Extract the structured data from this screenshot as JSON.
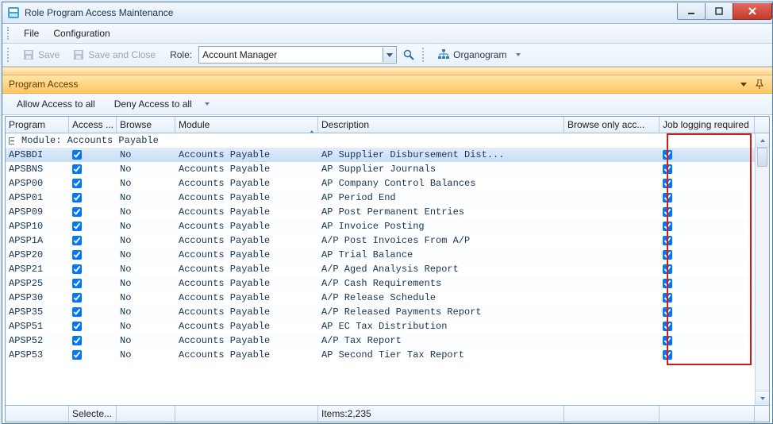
{
  "window": {
    "title": "Role Program Access Maintenance"
  },
  "menu": {
    "file": "File",
    "configuration": "Configuration"
  },
  "toolbar": {
    "save": "Save",
    "save_close": "Save and Close",
    "role_label": "Role:",
    "role_value": "Account Manager",
    "organogram": "Organogram"
  },
  "panel": {
    "title": "Program Access"
  },
  "access_bar": {
    "allow_all": "Allow Access to all",
    "deny_all": "Deny Access to all"
  },
  "columns": {
    "program": "Program",
    "access": "Access ...",
    "browse": "Browse",
    "module": "Module",
    "description": "Description",
    "browse_only": "Browse only acc...",
    "job_logging": "Job logging required"
  },
  "group": {
    "prefix_label": "Module:",
    "value": "Accounts Payable"
  },
  "rows": [
    {
      "program": "APSBDI",
      "access": true,
      "browse": "No",
      "module": "Accounts Payable",
      "description": "AP Supplier Disbursement Dist...",
      "joblog": true,
      "selected": true
    },
    {
      "program": "APSBNS",
      "access": true,
      "browse": "No",
      "module": "Accounts Payable",
      "description": "AP Supplier Journals",
      "joblog": true
    },
    {
      "program": "APSP00",
      "access": true,
      "browse": "No",
      "module": "Accounts Payable",
      "description": "AP Company Control Balances",
      "joblog": true
    },
    {
      "program": "APSP01",
      "access": true,
      "browse": "No",
      "module": "Accounts Payable",
      "description": "AP Period End",
      "joblog": true
    },
    {
      "program": "APSP09",
      "access": true,
      "browse": "No",
      "module": "Accounts Payable",
      "description": "AP Post Permanent Entries",
      "joblog": true
    },
    {
      "program": "APSP10",
      "access": true,
      "browse": "No",
      "module": "Accounts Payable",
      "description": "AP Invoice Posting",
      "joblog": true
    },
    {
      "program": "APSP1A",
      "access": true,
      "browse": "No",
      "module": "Accounts Payable",
      "description": "A/P Post Invoices From A/P",
      "joblog": true
    },
    {
      "program": "APSP20",
      "access": true,
      "browse": "No",
      "module": "Accounts Payable",
      "description": "AP Trial Balance",
      "joblog": true
    },
    {
      "program": "APSP21",
      "access": true,
      "browse": "No",
      "module": "Accounts Payable",
      "description": "A/P Aged Analysis Report",
      "joblog": true
    },
    {
      "program": "APSP25",
      "access": true,
      "browse": "No",
      "module": "Accounts Payable",
      "description": "A/P Cash Requirements",
      "joblog": true
    },
    {
      "program": "APSP30",
      "access": true,
      "browse": "No",
      "module": "Accounts Payable",
      "description": "A/P Release Schedule",
      "joblog": true
    },
    {
      "program": "APSP35",
      "access": true,
      "browse": "No",
      "module": "Accounts Payable",
      "description": "A/P Released Payments Report",
      "joblog": true
    },
    {
      "program": "APSP51",
      "access": true,
      "browse": "No",
      "module": "Accounts Payable",
      "description": "AP EC Tax Distribution",
      "joblog": true
    },
    {
      "program": "APSP52",
      "access": true,
      "browse": "No",
      "module": "Accounts Payable",
      "description": "A/P Tax Report",
      "joblog": true
    },
    {
      "program": "APSP53",
      "access": true,
      "browse": "No",
      "module": "Accounts Payable",
      "description": "AP Second Tier Tax Report",
      "joblog": true
    }
  ],
  "footer": {
    "selected_label": "Selecte...",
    "items_label": "Items:2,235"
  }
}
